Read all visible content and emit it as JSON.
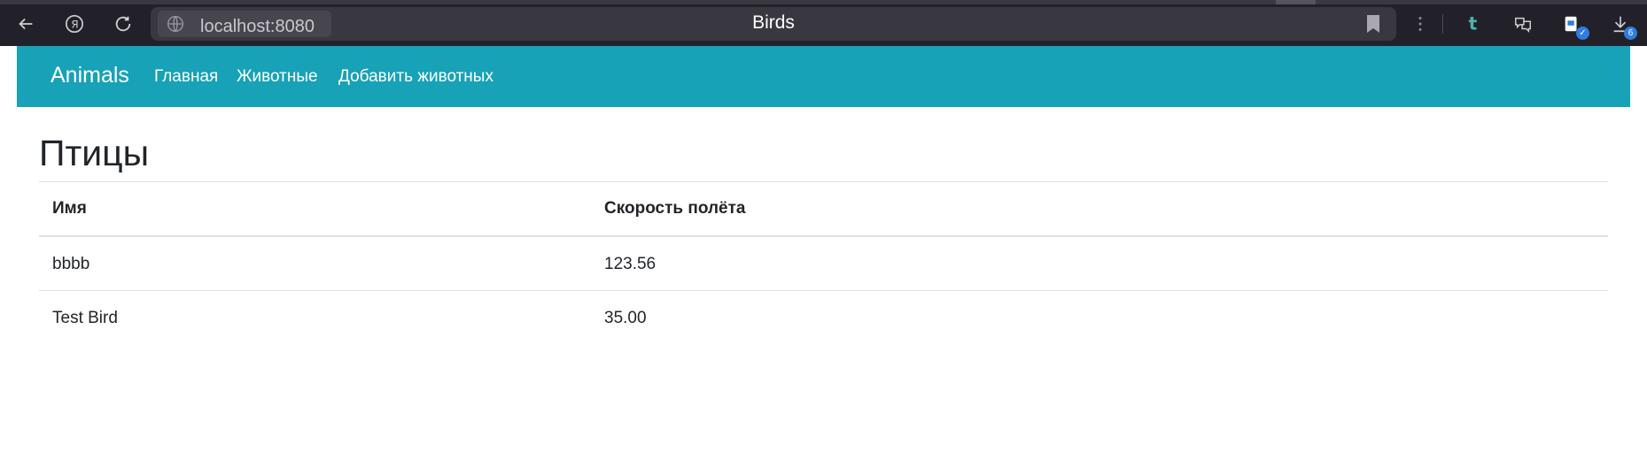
{
  "browser": {
    "url": "localhost:8080",
    "tab_title": "Birds",
    "downloads_count": "6",
    "icons": [
      "back-arrow-icon",
      "yandex-icon",
      "reload-icon",
      "site-info-icon",
      "bookmark-icon",
      "menu-dots-icon",
      "tumblr-icon",
      "translate-icon",
      "extension-icon",
      "download-icon"
    ]
  },
  "navbar": {
    "brand": "Animals",
    "links": [
      "Главная",
      "Животные",
      "Добавить животных"
    ],
    "background": "#17a2b8"
  },
  "page": {
    "heading": "Птицы",
    "table": {
      "headers": [
        "Имя",
        "Скорость полёта"
      ],
      "rows": [
        [
          "bbbb",
          "123.56"
        ],
        [
          "Test Bird",
          "35.00"
        ]
      ]
    }
  }
}
